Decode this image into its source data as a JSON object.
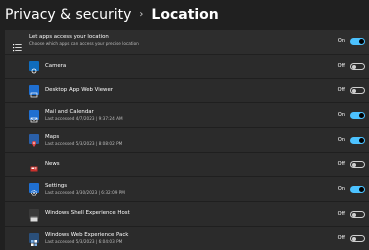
{
  "breadcrumb": {
    "parent": "Privacy & security",
    "separator": "›",
    "current": "Location"
  },
  "master": {
    "title": "Let apps access your location",
    "subtitle": "Choose which apps can access your precise location",
    "enabled": true,
    "state_label": "On",
    "icon": "list-icon"
  },
  "apps": [
    {
      "name": "Camera",
      "detail": "",
      "state_label": "Off",
      "enabled": false,
      "icon": "camera-app-icon",
      "icon_color": "#0f6cbd"
    },
    {
      "name": "Desktop App Web Viewer",
      "detail": "",
      "state_label": "Off",
      "enabled": false,
      "icon": "desktop-web-viewer-icon",
      "icon_color": "#1f6fd1"
    },
    {
      "name": "Mail and Calendar",
      "detail": "Last accessed 4/7/2023  |  9:37:24 AM",
      "state_label": "On",
      "enabled": true,
      "icon": "mail-calendar-icon",
      "icon_color": "#1f6fd1"
    },
    {
      "name": "Maps",
      "detail": "Last accessed 5/3/2023  |  8:08:02 PM",
      "state_label": "On",
      "enabled": true,
      "icon": "maps-icon",
      "icon_color": "#c9302c"
    },
    {
      "name": "News",
      "detail": "",
      "state_label": "Off",
      "enabled": false,
      "icon": "news-icon",
      "icon_color": "#c9302c"
    },
    {
      "name": "Settings",
      "detail": "Last accessed 3/30/2023  |  6:32:09 PM",
      "state_label": "On",
      "enabled": true,
      "icon": "settings-gear-icon",
      "icon_color": "#1f6fd1"
    },
    {
      "name": "Windows Shell Experience Host",
      "detail": "",
      "state_label": "Off",
      "enabled": false,
      "icon": "shell-host-icon",
      "icon_color": "#5a5a5a"
    },
    {
      "name": "Windows Web Experience Pack",
      "detail": "Last accessed 5/3/2023  |  6:04:03 PM",
      "state_label": "Off",
      "enabled": false,
      "icon": "web-experience-icon",
      "icon_color": "#2a4f7a"
    }
  ],
  "colors": {
    "background": "#202020",
    "row": "#2b2b2b",
    "accent": "#4cc2ff"
  }
}
